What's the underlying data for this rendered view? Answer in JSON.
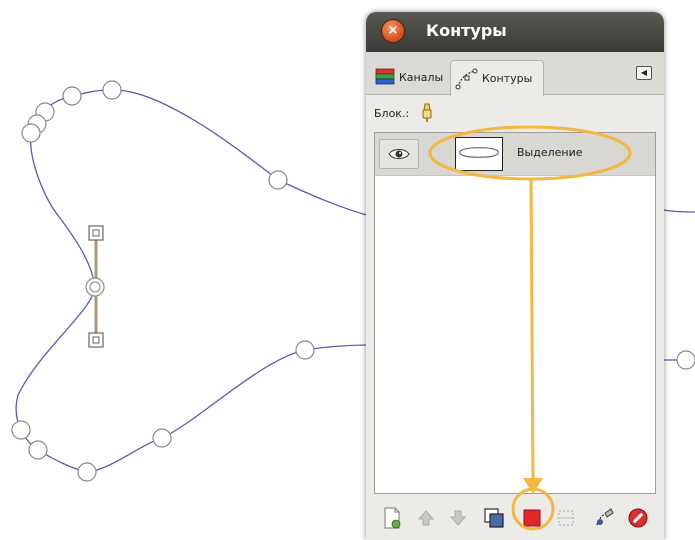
{
  "dialog": {
    "title": "Контуры",
    "close_icon": "close-icon"
  },
  "tabs": [
    {
      "label": "Каналы",
      "icon": "channels-icon",
      "active": false
    },
    {
      "label": "Контуры",
      "icon": "paths-icon",
      "active": true
    }
  ],
  "lock": {
    "label": "Блок.:",
    "icon": "lock-brush-icon"
  },
  "paths": [
    {
      "name": "Выделение",
      "visible": true
    }
  ],
  "toolbar": {
    "buttons": [
      {
        "name": "new-path",
        "icon": "new-path-icon"
      },
      {
        "name": "raise-path",
        "icon": "arrow-up-icon"
      },
      {
        "name": "lower-path",
        "icon": "arrow-down-icon"
      },
      {
        "name": "duplicate-path",
        "icon": "duplicate-icon"
      },
      {
        "name": "path-to-selection",
        "icon": "path-to-selection-icon"
      },
      {
        "name": "selection-to-path",
        "icon": "selection-to-path-icon"
      },
      {
        "name": "paint-along-path",
        "icon": "paint-path-icon"
      },
      {
        "name": "delete-path",
        "icon": "delete-icon"
      }
    ]
  },
  "colors": {
    "path_stroke": "#5a5ab0",
    "highlight": "#f2b840",
    "titlebar": "#3b3a36",
    "selection_red": "#e02828"
  }
}
